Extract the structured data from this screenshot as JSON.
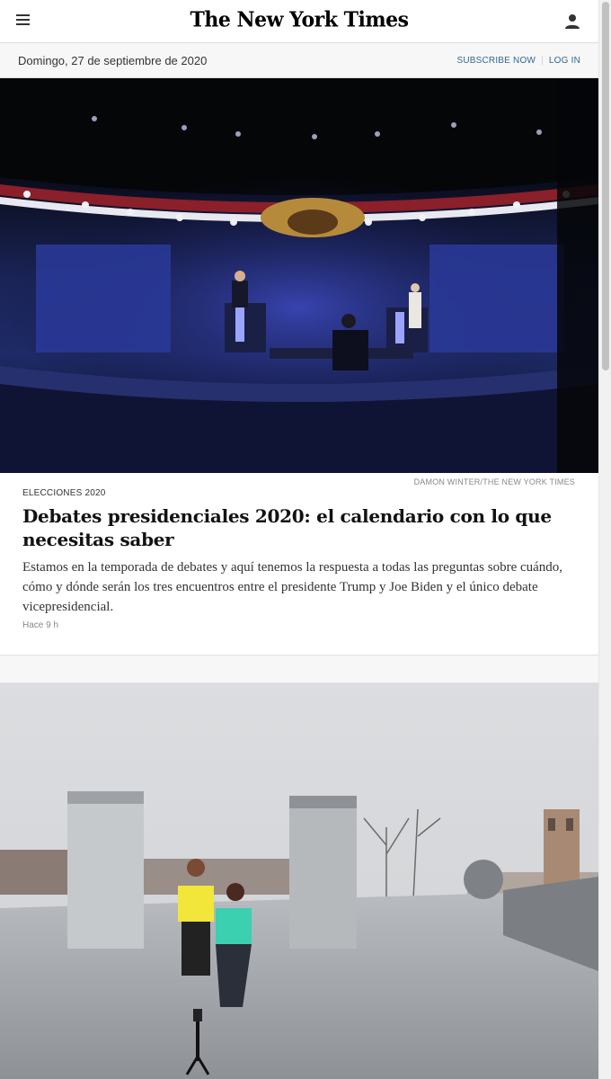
{
  "header": {
    "logo": "The New York Times",
    "menu_icon": "hamburger-menu-icon",
    "user_icon": "user-account-icon"
  },
  "datebar": {
    "date": "Domingo, 27 de septiembre de 2020",
    "subscribe": "SUBSCRIBE NOW",
    "login": "LOG IN"
  },
  "lead": {
    "credit": "DAMON WINTER/THE NEW YORK TIMES",
    "kicker": "ELECCIONES 2020",
    "headline": "Debates presidenciales 2020: el calendario con lo que necesitas saber",
    "summary": "Estamos en la temporada de debates y aquí tenemos la respuesta a todas las preguntas sobre cuándo, cómo y dónde serán los tres encuentros entre el presidente Trump y Joe Biden y el único debate vicepresidencial.",
    "time": "Hace 9 h"
  },
  "colors": {
    "link": "#326891",
    "text": "#121212",
    "muted": "#888888"
  }
}
